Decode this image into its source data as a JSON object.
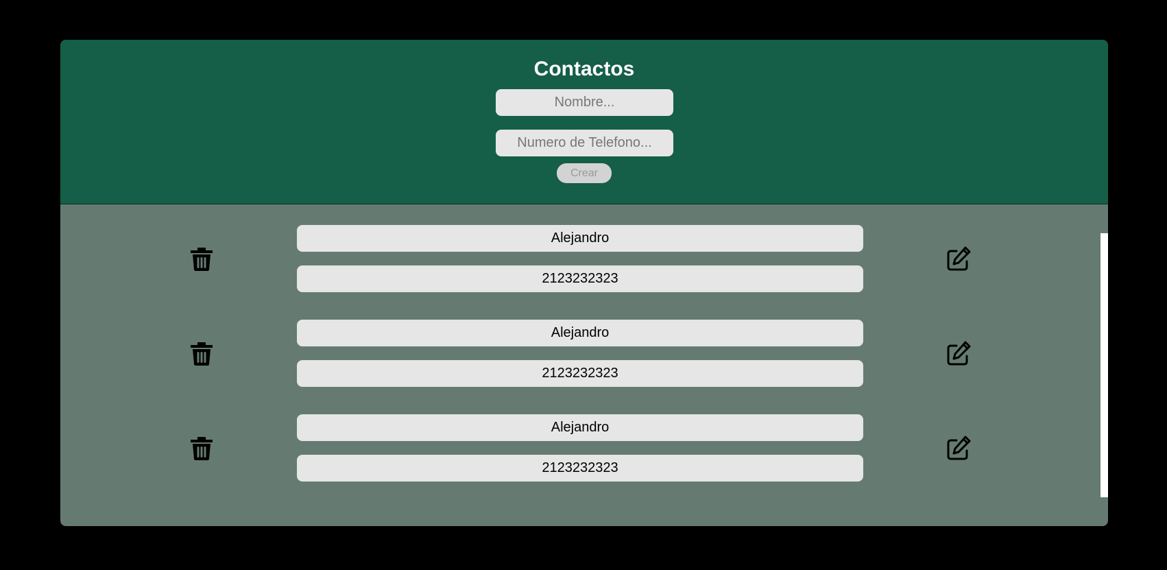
{
  "header": {
    "title": "Contactos",
    "name_placeholder": "Nombre...",
    "phone_placeholder": "Numero de Telefono...",
    "create_label": "Crear"
  },
  "contacts": [
    {
      "name": "Alejandro",
      "phone": "2123232323"
    },
    {
      "name": "Alejandro",
      "phone": "2123232323"
    },
    {
      "name": "Alejandro",
      "phone": "2123232323"
    }
  ],
  "icons": {
    "delete": "trash-icon",
    "edit": "edit-icon"
  },
  "colors": {
    "header_bg": "#155e47",
    "list_bg": "#657b72",
    "field_bg": "#e6e6e6"
  }
}
